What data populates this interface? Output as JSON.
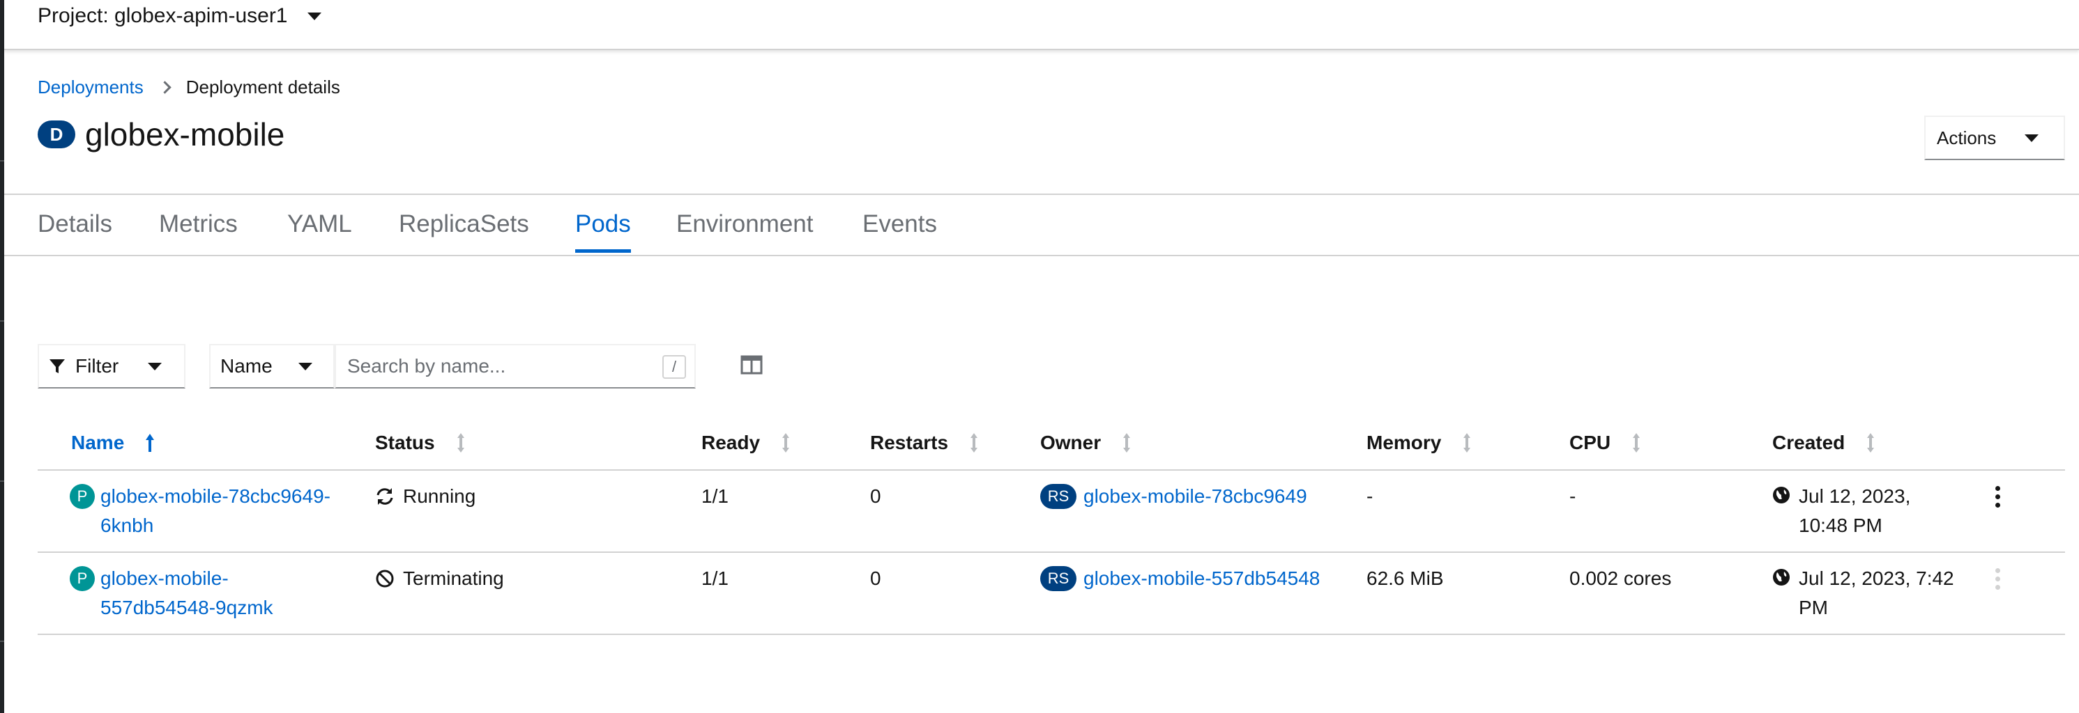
{
  "project": {
    "label": "Project: globex-apim-user1"
  },
  "breadcrumb": {
    "parent": "Deployments",
    "current": "Deployment details"
  },
  "title": {
    "badge": "D",
    "name": "globex-mobile"
  },
  "actions": {
    "label": "Actions"
  },
  "tabs": [
    "Details",
    "Metrics",
    "YAML",
    "ReplicaSets",
    "Pods",
    "Environment",
    "Events"
  ],
  "active_tab": "Pods",
  "toolbar": {
    "filter_label": "Filter",
    "name_select": "Name",
    "search_placeholder": "Search by name...",
    "search_shortcut": "/"
  },
  "table": {
    "columns": [
      "Name",
      "Status",
      "Ready",
      "Restarts",
      "Owner",
      "Memory",
      "CPU",
      "Created"
    ],
    "rows": [
      {
        "pod_badge": "P",
        "name_line1": "globex-mobile-78cbc9649-",
        "name_line2": "6knbh",
        "status": "Running",
        "status_icon": "sync-icon",
        "ready": "1/1",
        "restarts": "0",
        "owner_badge": "RS",
        "owner": "globex-mobile-78cbc9649",
        "memory": "-",
        "cpu": "-",
        "created_line1": "Jul 12, 2023,",
        "created_line2": "10:48 PM"
      },
      {
        "pod_badge": "P",
        "name_line1": "globex-mobile-",
        "name_line2": "557db54548-9qzmk",
        "status": "Terminating",
        "status_icon": "ban-icon",
        "ready": "1/1",
        "restarts": "0",
        "owner_badge": "RS",
        "owner": "globex-mobile-557db54548",
        "memory": "62.6 MiB",
        "cpu": "0.002 cores",
        "created_line1": "Jul 12, 2023, 7:42",
        "created_line2": "PM"
      }
    ]
  },
  "colors": {
    "link": "#0066cc",
    "pod_badge": "#009596",
    "rs_badge": "#004080",
    "deployment_badge": "#004080"
  }
}
